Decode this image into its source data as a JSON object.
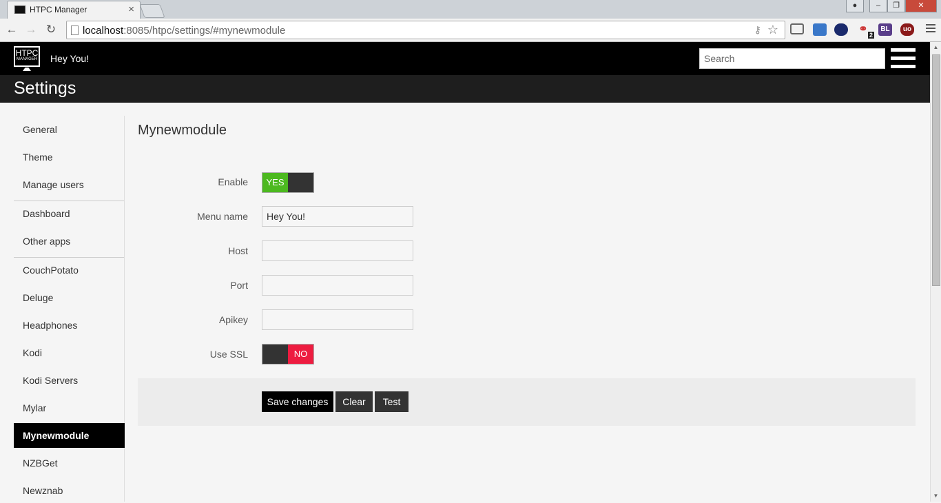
{
  "browser": {
    "tab_title": "HTPC Manager",
    "tab_close": "×",
    "url_host": "localhost",
    "url_rest": ":8085/htpc/settings/#mynewmodule",
    "ext_badge_count": "2",
    "ext_bl_label": "BL",
    "ext_ublock_label": "uo"
  },
  "app": {
    "logo_line1": "HTPC",
    "logo_line2": "MANAGER",
    "brand": "Hey You!",
    "search_placeholder": "Search",
    "page_title": "Settings"
  },
  "sidebar": {
    "items": [
      {
        "label": "General"
      },
      {
        "label": "Theme"
      },
      {
        "label": "Manage users"
      },
      {
        "label": "Dashboard"
      },
      {
        "label": "Other apps"
      },
      {
        "label": "CouchPotato"
      },
      {
        "label": "Deluge"
      },
      {
        "label": "Headphones"
      },
      {
        "label": "Kodi"
      },
      {
        "label": "Kodi Servers"
      },
      {
        "label": "Mylar"
      },
      {
        "label": "Mynewmodule",
        "active": true
      },
      {
        "label": "NZBGet"
      },
      {
        "label": "Newznab"
      }
    ]
  },
  "module": {
    "title": "Mynewmodule",
    "fields": {
      "enable": {
        "label": "Enable",
        "state": "YES"
      },
      "menu_name": {
        "label": "Menu name",
        "value": "Hey You!"
      },
      "host": {
        "label": "Host",
        "value": ""
      },
      "port": {
        "label": "Port",
        "value": ""
      },
      "apikey": {
        "label": "Apikey",
        "value": ""
      },
      "use_ssl": {
        "label": "Use SSL",
        "state": "NO"
      }
    },
    "buttons": {
      "save": "Save changes",
      "clear": "Clear",
      "test": "Test"
    }
  },
  "colors": {
    "toggle_yes": "#4cb91f",
    "toggle_no": "#ed1c40",
    "header_bg": "#000000",
    "settings_bar_bg": "#1e1e1e"
  }
}
